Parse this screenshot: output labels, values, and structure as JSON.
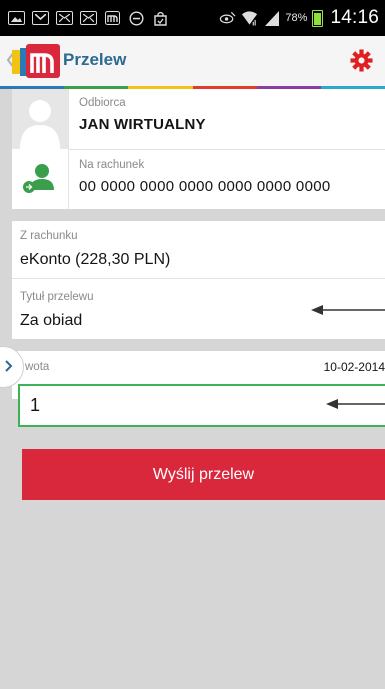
{
  "status_bar": {
    "battery_percent": "78%",
    "time": "14:16"
  },
  "action_bar": {
    "title": "Przelew",
    "icons": [
      "back-chevron-icon",
      "mbank-logo-icon",
      "settings-gear-icon"
    ]
  },
  "colors": {
    "brand_red": "#d9283c",
    "title_blue": "#2c6a92",
    "settings_red": "#e02020",
    "input_green": "#3fb255",
    "strip": [
      "#2b7ab8",
      "#3a9e4c",
      "#f2c21b",
      "#e23b2e",
      "#8a3fa0",
      "#2aa9c9"
    ]
  },
  "recipient": {
    "label": "Odbiorca",
    "name": "JAN WIRTUALNY",
    "account_label": "Na rachunek",
    "account_number": "00 0000 0000 0000 0000 0000 0000"
  },
  "from_account": {
    "label": "Z rachunku",
    "value": "eKonto  (228,30 PLN)"
  },
  "transfer_title": {
    "label": "Tytuł przelewu",
    "value": "Za obiad"
  },
  "amount": {
    "label": "wota",
    "date": "10-02-2014",
    "value": "1"
  },
  "submit": {
    "label": "Wyślij przelew"
  }
}
